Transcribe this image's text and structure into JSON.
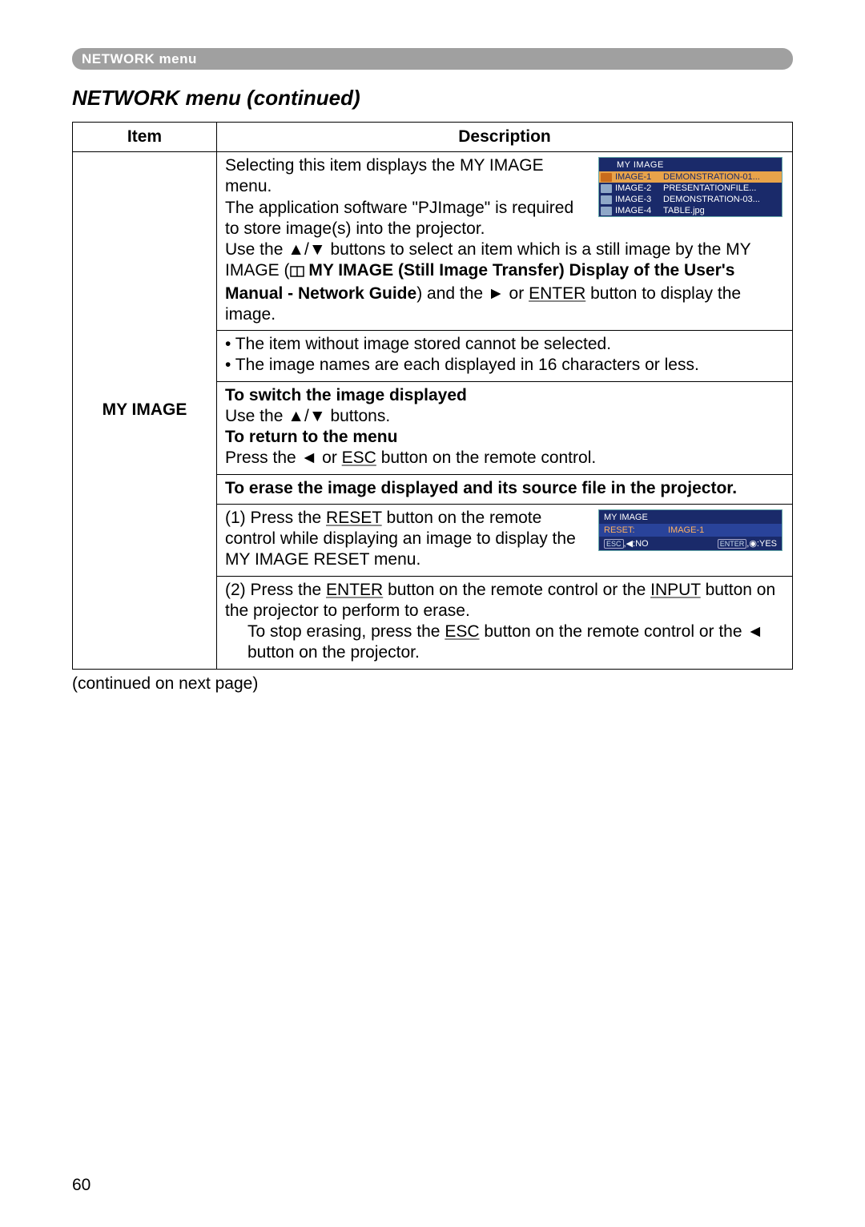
{
  "header": {
    "breadcrumb": "NETWORK menu"
  },
  "section_title": "NETWORK menu (continued)",
  "table": {
    "headers": {
      "item": "Item",
      "desc": "Description"
    },
    "item": "MY IMAGE"
  },
  "osd1": {
    "title": "MY IMAGE",
    "rows": [
      {
        "label": "IMAGE-1",
        "value": "DEMONSTRATION-01..."
      },
      {
        "label": "IMAGE-2",
        "value": "PRESENTATIONFILE..."
      },
      {
        "label": "IMAGE-3",
        "value": "DEMONSTRATION-03..."
      },
      {
        "label": "IMAGE-4",
        "value": "TABLE.jpg"
      }
    ]
  },
  "osd2": {
    "title": "MY IMAGE",
    "reset_label": "RESET:",
    "reset_value": "IMAGE-1",
    "left": "ESC, ◀:NO",
    "right": "ENTER, ◉:YES",
    "esc_box": "ESC",
    "left_text": ",◀:NO",
    "enter_box": "ENTER",
    "right_text": ",◉:YES"
  },
  "desc": {
    "p1a": "Selecting this item displays the MY IMAGE menu.",
    "p1b": "The application software \"PJImage\" is required to store image(s) into the projector.",
    "p1c_a": "Use the ▲/▼ buttons to select an item which is a still image by the MY IMAGE (",
    "p1c_b": " MY IMAGE (Still Image Transfer) Display of the User's Manual - Network Guide",
    "p1c_c": ") and the ► or ",
    "p1c_enter": "ENTER",
    "p1c_d": " button to display the image.",
    "p2a": "• The item without image stored cannot be selected.",
    "p2b": "• The image names are each displayed in 16 characters or less.",
    "h1": "To switch the image displayed",
    "p3": "Use the ▲/▼ buttons.",
    "h2": "To return to the menu",
    "p4a": "Press the ◄ or ",
    "p4_esc": "ESC",
    "p4b": " button on the remote control.",
    "h3": "To erase the image displayed and its source file in the projector.",
    "p5a": "(1) Press the ",
    "p5_reset": "RESET",
    "p5b": " button on the remote control while displaying an image to display the MY IMAGE RESET menu.",
    "p6a": "(2) Press the ",
    "p6_enter": "ENTER",
    "p6b": " button on the remote control or the ",
    "p6_input": "INPUT",
    "p6c": " button on the projector to perform to erase.",
    "p6d": "To stop erasing, press the ",
    "p6_esc": "ESC",
    "p6e": " button on the remote control or the ◄ button on the projector."
  },
  "continued": "(continued on next page)",
  "page": "60"
}
